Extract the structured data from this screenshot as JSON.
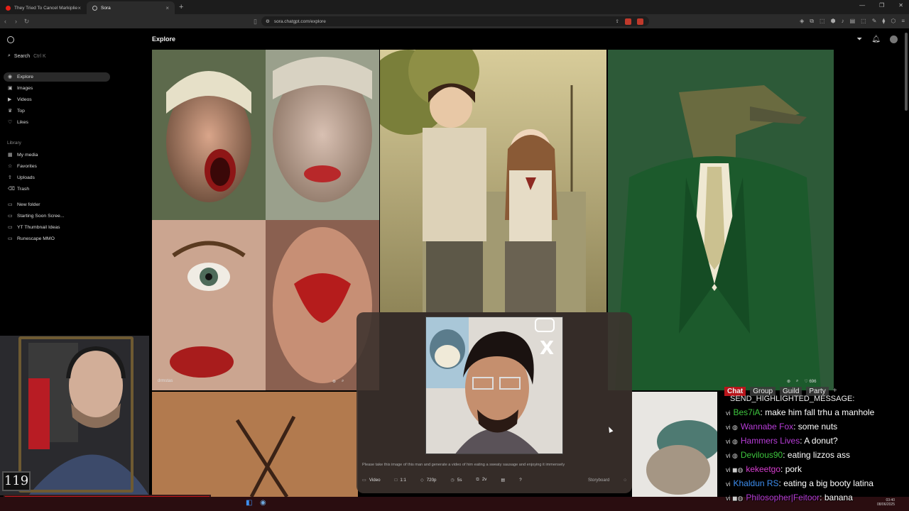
{
  "browser": {
    "tabs": [
      {
        "label": "They Tried To Cancel Markiplier... It B",
        "active": false,
        "favicon_color": "#e62117"
      },
      {
        "label": "Sora",
        "active": true,
        "favicon_color": "#888888"
      }
    ],
    "url": "sora.chatgpt.com/explore"
  },
  "sidebar": {
    "search_label": "Search",
    "search_shortcut": "Ctrl K",
    "nav": [
      {
        "label": "Explore",
        "icon": "compass-icon",
        "active": true
      },
      {
        "label": "Images",
        "icon": "image-icon"
      },
      {
        "label": "Videos",
        "icon": "video-icon"
      },
      {
        "label": "Top",
        "icon": "trophy-icon"
      },
      {
        "label": "Likes",
        "icon": "heart-icon"
      }
    ],
    "library_label": "Library",
    "library": [
      {
        "label": "My media",
        "icon": "media-icon"
      },
      {
        "label": "Favorites",
        "icon": "star-icon"
      },
      {
        "label": "Uploads",
        "icon": "upload-icon"
      },
      {
        "label": "Trash",
        "icon": "trash-icon"
      }
    ],
    "folders": [
      {
        "label": "New folder",
        "icon": "folder-plus-icon"
      },
      {
        "label": "Starting Soon Scree...",
        "icon": "folder-icon"
      },
      {
        "label": "YT Thumbnail Ideas",
        "icon": "folder-icon"
      },
      {
        "label": "Runescape MMO",
        "icon": "folder-icon"
      }
    ]
  },
  "main": {
    "title": "Explore",
    "tiles": [
      {
        "author": "drmstas"
      },
      {
        "likes": "696"
      }
    ]
  },
  "composer": {
    "prompt": "Please take this image of this man and generate a video of him eating a sweaty sausage and enjoying it immensely",
    "type": "Video",
    "aspect": "1:1",
    "resolution": "720p",
    "duration": "5s",
    "variations": "2v",
    "help": "?",
    "storyboard": "Storyboard"
  },
  "stream": {
    "level": "119",
    "chat": {
      "tabs": [
        "Chat",
        "Group",
        "Guild",
        "Party"
      ],
      "top_line": "SEND_HIGHLIGHTED_MESSAGE:",
      "messages": [
        {
          "user": "Bes7iA",
          "color": "#3ec63e",
          "text": "make him fall trhu a manhole"
        },
        {
          "user": "Wannabe Fox",
          "color": "#b83dd8",
          "text": "some nuts"
        },
        {
          "user": "Hammers Lives",
          "color": "#b83dd8",
          "text": "A donut?"
        },
        {
          "user": "Devilous90",
          "color": "#3ec63e",
          "text": "eating lizzos ass"
        },
        {
          "user": "kekeetgo",
          "color": "#d83dd0",
          "text": "pork"
        },
        {
          "user": "Khaldun RS",
          "color": "#3d8ef0",
          "text": "eating a big booty latina"
        },
        {
          "user": "Philosopher|Feitoor",
          "color": "#b83dd8",
          "text": "banana"
        }
      ]
    },
    "clock": {
      "time": "03:40",
      "date": "08/06/2025"
    }
  }
}
